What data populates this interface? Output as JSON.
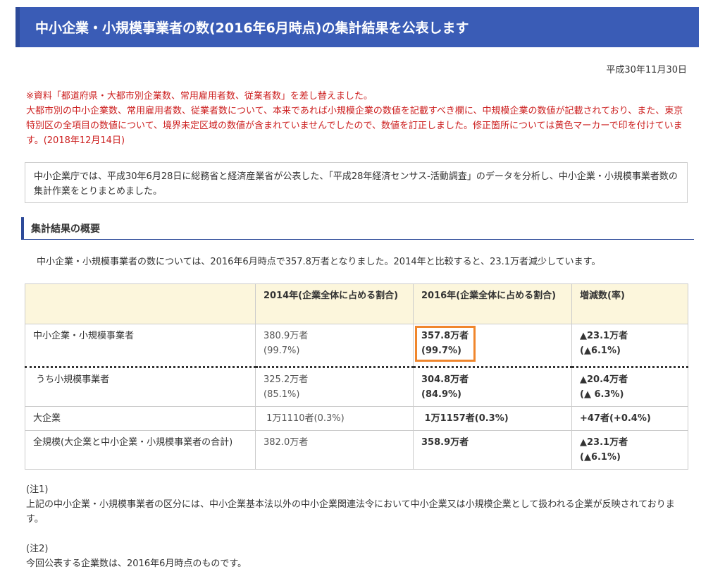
{
  "header": {
    "title": "中小企業・小規模事業者の数(2016年6月時点)の集計結果を公表します"
  },
  "date": "平成30年11月30日",
  "notice": {
    "line1": "※資料「都道府県・大都市別企業数、常用雇用者数、従業者数」を差し替えました。",
    "line2": "大都市別の中小企業数、常用雇用者数、従業者数について、本来であれば小規模企業の数値を記載すべき欄に、中規模企業の数値が記載されており、また、東京特別区の全項目の数値について、境界未定区域の数値が含まれていませんでしたので、数値を訂正しました。修正箇所については黄色マーカーで印を付けています。(2018年12月14日)"
  },
  "intro": "中小企業庁では、平成30年6月28日に総務省と経済産業省が公表した、「平成28年経済センサス-活動調査」のデータを分析し、中小企業・小規模事業者数の集計作業をとりまとめました。",
  "section": {
    "title": "集計結果の概要"
  },
  "summary": "中小企業・小規模事業者の数については、2016年6月時点で357.8万者となりました。2014年と比較すると、23.1万者減少しています。",
  "table": {
    "headers": [
      "",
      "2014年(企業全体に占める割合)",
      "2016年(企業全体に占める割合)",
      "増減数(率)"
    ],
    "rows": [
      {
        "label": "中小企業・小規模事業者",
        "y2014": "380.9万者",
        "y2014b": "(99.7%)",
        "y2016": "357.8万者",
        "y2016b": "(99.7%)",
        "change": "▲23.1万者",
        "changeb": "(▲6.1%)"
      },
      {
        "label": "うち小規模事業者",
        "y2014": "325.2万者",
        "y2014b": "(85.1%)",
        "y2016": "304.8万者",
        "y2016b": "(84.9%)",
        "change": "▲20.4万者",
        "changeb": "(▲ 6.3%)"
      },
      {
        "label": "大企業",
        "y2014": "1万1110者(0.3%)",
        "y2016": "1万1157者(0.3%)",
        "change": "+47者(+0.4%)"
      },
      {
        "label": "全規模(大企業と中小企業・小規模事業者の合計)",
        "y2014": "382.0万者",
        "y2016": "358.9万者",
        "change": "▲23.1万者",
        "changeb": "(▲6.1%)"
      }
    ]
  },
  "notes": {
    "note1_title": "(注1)",
    "note1_text": "上記の中小企業・小規模事業者の区分には、中小企業基本法以外の中小企業関連法令において中小企業又は小規模企業として扱われる企業が反映されております。",
    "note2_title": "(注2)",
    "note2_text": "今回公表する企業数は、2016年6月時点のものです。"
  },
  "colors": {
    "title_bar": "#3a5cb6",
    "notice_text": "#cc1f1f",
    "table_header": "#fcf6dc",
    "highlight_border": "#f0862c"
  }
}
